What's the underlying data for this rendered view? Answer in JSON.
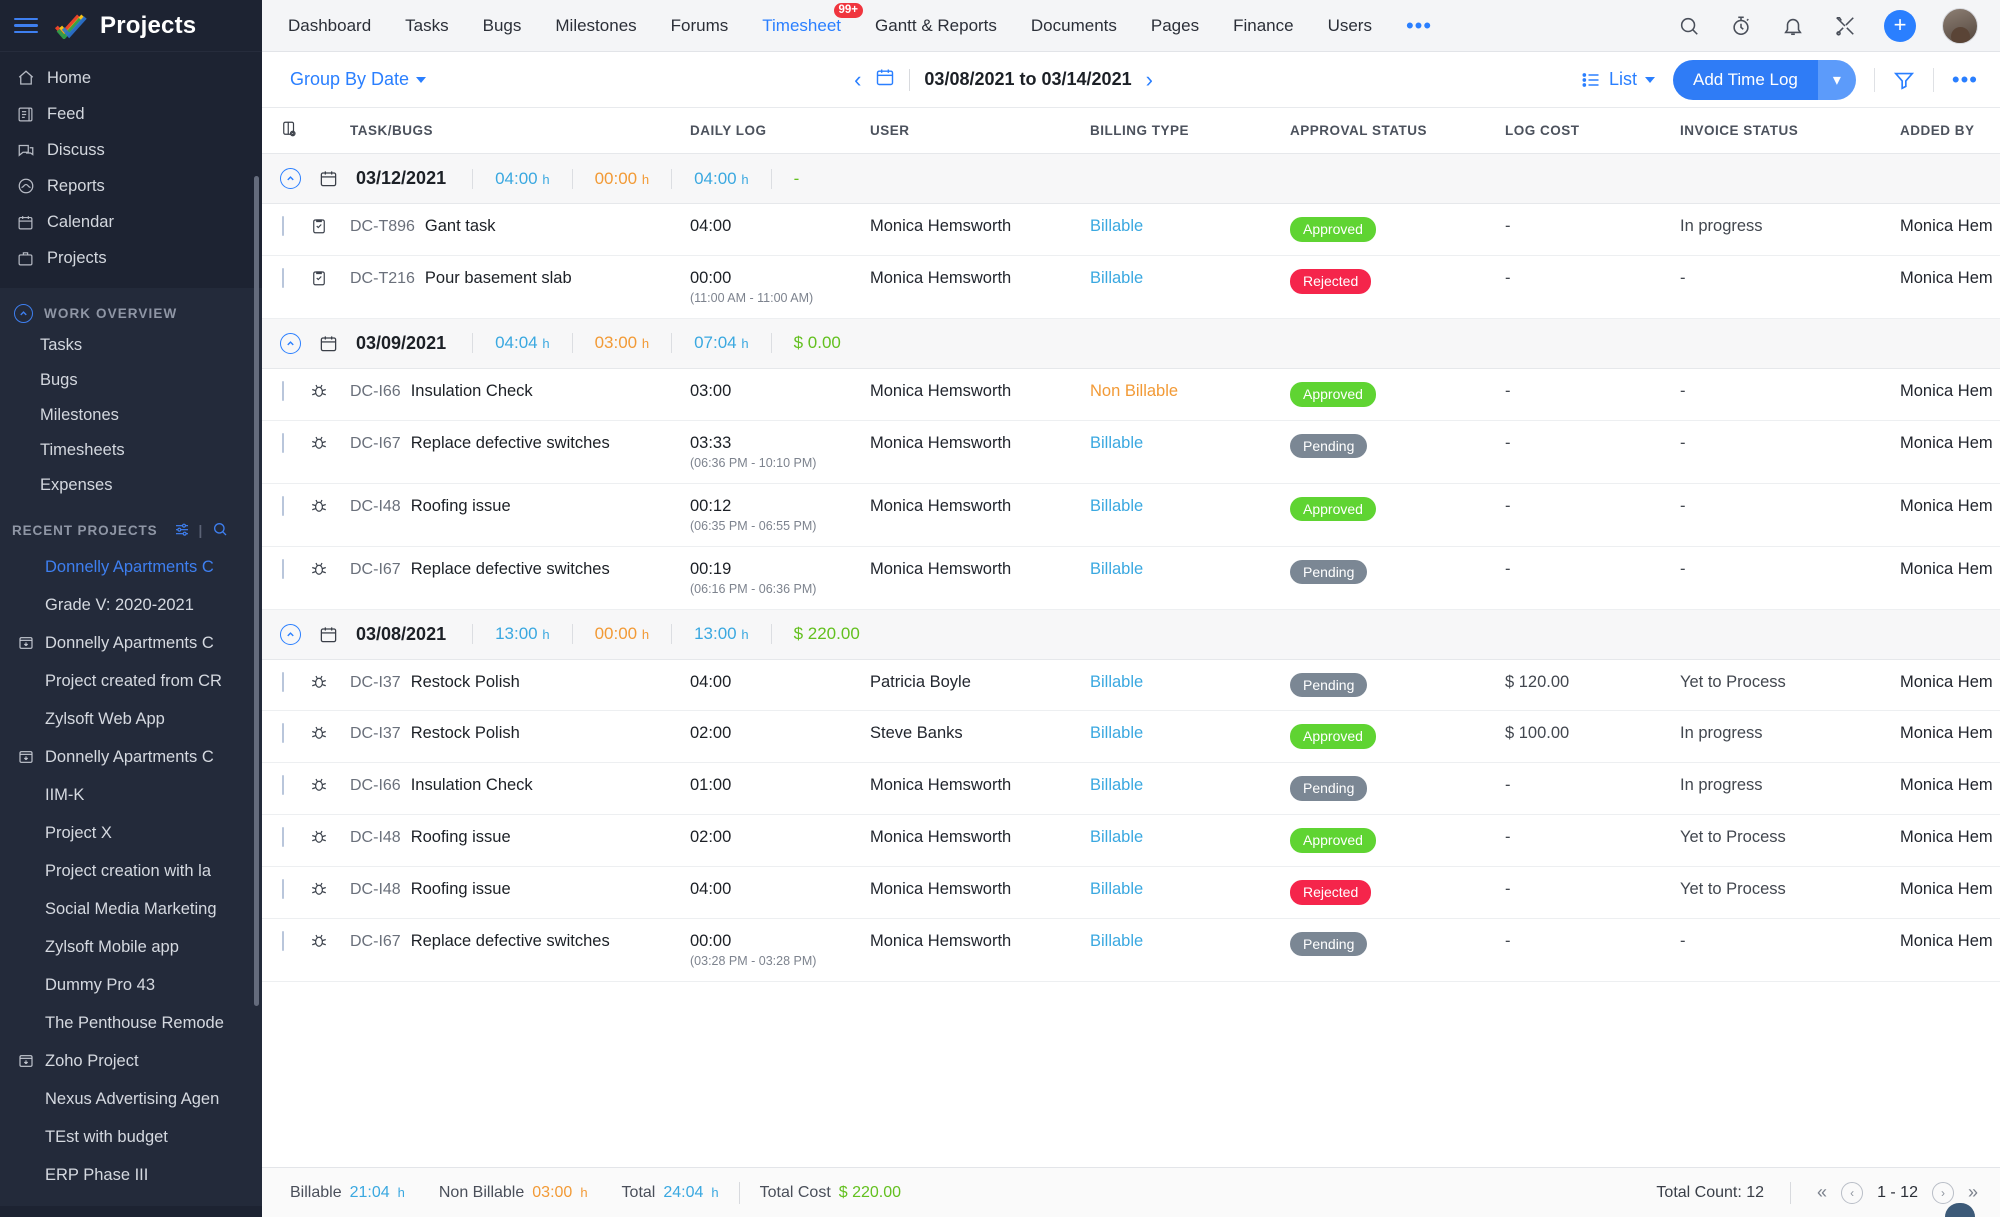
{
  "brand": {
    "name": "Projects",
    "hamburger_icon": "hamburger-icon",
    "logo_icon": "zoho-projects-logo-icon"
  },
  "sidebar": {
    "primary": [
      {
        "label": "Home",
        "icon": "home-icon"
      },
      {
        "label": "Feed",
        "icon": "feed-icon"
      },
      {
        "label": "Discuss",
        "icon": "discuss-icon"
      },
      {
        "label": "Reports",
        "icon": "reports-icon"
      },
      {
        "label": "Calendar",
        "icon": "calendar-icon"
      },
      {
        "label": "Projects",
        "icon": "projects-icon"
      }
    ],
    "work_overview": {
      "title": "WORK OVERVIEW",
      "collapse_icon": "chevron-up-circle-icon",
      "items": [
        {
          "label": "Tasks"
        },
        {
          "label": "Bugs"
        },
        {
          "label": "Milestones"
        },
        {
          "label": "Timesheets"
        },
        {
          "label": "Expenses"
        }
      ]
    },
    "recent_projects": {
      "title": "RECENT PROJECTS",
      "filter_icon": "sliders-icon",
      "search_icon": "search-icon",
      "items": [
        {
          "label": "Donnelly Apartments C",
          "active": true,
          "has_icon": false
        },
        {
          "label": "Grade V: 2020-2021",
          "active": false,
          "has_icon": false
        },
        {
          "label": "Donnelly Apartments C",
          "active": false,
          "has_icon": true
        },
        {
          "label": "Project created from CR",
          "active": false,
          "has_icon": false
        },
        {
          "label": "Zylsoft Web App",
          "active": false,
          "has_icon": false
        },
        {
          "label": "Donnelly Apartments C",
          "active": false,
          "has_icon": true
        },
        {
          "label": "IIM-K",
          "active": false,
          "has_icon": false
        },
        {
          "label": "Project X",
          "active": false,
          "has_icon": false
        },
        {
          "label": "Project creation with la",
          "active": false,
          "has_icon": false
        },
        {
          "label": "Social Media Marketing",
          "active": false,
          "has_icon": false
        },
        {
          "label": "Zylsoft Mobile app",
          "active": false,
          "has_icon": false
        },
        {
          "label": "Dummy Pro 43",
          "active": false,
          "has_icon": false
        },
        {
          "label": "The Penthouse Remode",
          "active": false,
          "has_icon": false
        },
        {
          "label": "Zoho Project",
          "active": false,
          "has_icon": true
        },
        {
          "label": "Nexus Advertising Agen",
          "active": false,
          "has_icon": false
        },
        {
          "label": "TEst with budget",
          "active": false,
          "has_icon": false
        },
        {
          "label": "ERP Phase III",
          "active": false,
          "has_icon": false
        }
      ]
    }
  },
  "topnav": {
    "items": [
      {
        "label": "Dashboard",
        "active": false
      },
      {
        "label": "Tasks",
        "active": false
      },
      {
        "label": "Bugs",
        "active": false
      },
      {
        "label": "Milestones",
        "active": false
      },
      {
        "label": "Forums",
        "active": false
      },
      {
        "label": "Timesheet",
        "active": true,
        "badge": "99+"
      },
      {
        "label": "Gantt & Reports",
        "active": false
      },
      {
        "label": "Documents",
        "active": false
      },
      {
        "label": "Pages",
        "active": false
      },
      {
        "label": "Finance",
        "active": false
      },
      {
        "label": "Users",
        "active": false
      }
    ],
    "more_label": "•••",
    "icons": [
      {
        "name": "search-icon"
      },
      {
        "name": "timer-icon"
      },
      {
        "name": "notification-bell-icon"
      },
      {
        "name": "tools-icon"
      }
    ],
    "add_label": "+",
    "avatar_name": "user-avatar"
  },
  "toolbar": {
    "group_by_label": "Group By Date",
    "prev_label": "‹",
    "next_label": "›",
    "calendar_icon": "calendar-icon",
    "date_range": "03/08/2021 to 03/14/2021",
    "view_label": "List",
    "view_icon": "list-icon",
    "add_time_log_label": "Add Time Log",
    "add_time_log_caret": "▾",
    "filter_icon": "filter-icon",
    "more_icon": "more-options-icon"
  },
  "table": {
    "settings_icon": "column-settings-icon",
    "headers": {
      "task": "TASK/BUGS",
      "daily_log": "DAILY LOG",
      "user": "USER",
      "billing": "BILLING TYPE",
      "approval": "APPROVAL STATUS",
      "cost": "LOG COST",
      "invoice": "INVOICE STATUS",
      "added_by": "ADDED BY"
    },
    "groups": [
      {
        "date": "03/12/2021",
        "billable": "04:00",
        "non_billable": "00:00",
        "total": "04:00",
        "cost": "-",
        "unit": "h",
        "rows": [
          {
            "icon": "task-icon",
            "id": "DC-T896",
            "name": "Gant task",
            "log": "04:00",
            "log_sub": "",
            "user": "Monica Hemsworth",
            "billing": "Billable",
            "billing_type": "billable",
            "approval": "Approved",
            "approval_type": "approved",
            "cost": "-",
            "invoice": "In progress",
            "added_by": "Monica Hem"
          },
          {
            "icon": "task-icon",
            "id": "DC-T216",
            "name": "Pour basement slab",
            "log": "00:00",
            "log_sub": "(11:00 AM - 11:00 AM)",
            "user": "Monica Hemsworth",
            "billing": "Billable",
            "billing_type": "billable",
            "approval": "Rejected",
            "approval_type": "rejected",
            "cost": "-",
            "invoice": "-",
            "added_by": "Monica Hem"
          }
        ]
      },
      {
        "date": "03/09/2021",
        "billable": "04:04",
        "non_billable": "03:00",
        "total": "07:04",
        "cost": "$ 0.00",
        "unit": "h",
        "rows": [
          {
            "icon": "bug-icon",
            "id": "DC-I66",
            "name": "Insulation Check",
            "log": "03:00",
            "log_sub": "",
            "user": "Monica Hemsworth",
            "billing": "Non Billable",
            "billing_type": "nonbillable",
            "approval": "Approved",
            "approval_type": "approved",
            "cost": "-",
            "invoice": "-",
            "added_by": "Monica Hem"
          },
          {
            "icon": "bug-icon",
            "id": "DC-I67",
            "name": "Replace defective switches",
            "log": "03:33",
            "log_sub": "(06:36 PM - 10:10 PM)",
            "user": "Monica Hemsworth",
            "billing": "Billable",
            "billing_type": "billable",
            "approval": "Pending",
            "approval_type": "pending",
            "cost": "-",
            "invoice": "-",
            "added_by": "Monica Hem"
          },
          {
            "icon": "bug-icon",
            "id": "DC-I48",
            "name": "Roofing issue",
            "log": "00:12",
            "log_sub": "(06:35 PM - 06:55 PM)",
            "user": "Monica Hemsworth",
            "billing": "Billable",
            "billing_type": "billable",
            "approval": "Approved",
            "approval_type": "approved",
            "cost": "-",
            "invoice": "-",
            "added_by": "Monica Hem"
          },
          {
            "icon": "bug-icon",
            "id": "DC-I67",
            "name": "Replace defective switches",
            "log": "00:19",
            "log_sub": "(06:16 PM - 06:36 PM)",
            "user": "Monica Hemsworth",
            "billing": "Billable",
            "billing_type": "billable",
            "approval": "Pending",
            "approval_type": "pending",
            "cost": "-",
            "invoice": "-",
            "added_by": "Monica Hem"
          }
        ]
      },
      {
        "date": "03/08/2021",
        "billable": "13:00",
        "non_billable": "00:00",
        "total": "13:00",
        "cost": "$ 220.00",
        "unit": "h",
        "rows": [
          {
            "icon": "bug-icon",
            "id": "DC-I37",
            "name": "Restock Polish",
            "log": "04:00",
            "log_sub": "",
            "user": "Patricia Boyle",
            "billing": "Billable",
            "billing_type": "billable",
            "approval": "Pending",
            "approval_type": "pending",
            "cost": "$ 120.00",
            "invoice": "Yet to Process",
            "added_by": "Monica Hem"
          },
          {
            "icon": "bug-icon",
            "id": "DC-I37",
            "name": "Restock Polish",
            "log": "02:00",
            "log_sub": "",
            "user": "Steve Banks",
            "billing": "Billable",
            "billing_type": "billable",
            "approval": "Approved",
            "approval_type": "approved",
            "cost": "$ 100.00",
            "invoice": "In progress",
            "added_by": "Monica Hem"
          },
          {
            "icon": "bug-icon",
            "id": "DC-I66",
            "name": "Insulation Check",
            "log": "01:00",
            "log_sub": "",
            "user": "Monica Hemsworth",
            "billing": "Billable",
            "billing_type": "billable",
            "approval": "Pending",
            "approval_type": "pending",
            "cost": "-",
            "invoice": "In progress",
            "added_by": "Monica Hem"
          },
          {
            "icon": "bug-icon",
            "id": "DC-I48",
            "name": "Roofing issue",
            "log": "02:00",
            "log_sub": "",
            "user": "Monica Hemsworth",
            "billing": "Billable",
            "billing_type": "billable",
            "approval": "Approved",
            "approval_type": "approved",
            "cost": "-",
            "invoice": "Yet to Process",
            "added_by": "Monica Hem"
          },
          {
            "icon": "bug-icon",
            "id": "DC-I48",
            "name": "Roofing issue",
            "log": "04:00",
            "log_sub": "",
            "user": "Monica Hemsworth",
            "billing": "Billable",
            "billing_type": "billable",
            "approval": "Rejected",
            "approval_type": "rejected",
            "cost": "-",
            "invoice": "Yet to Process",
            "added_by": "Monica Hem"
          },
          {
            "icon": "bug-icon",
            "id": "DC-I67",
            "name": "Replace defective switches",
            "log": "00:00",
            "log_sub": "(03:28 PM - 03:28 PM)",
            "user": "Monica Hemsworth",
            "billing": "Billable",
            "billing_type": "billable",
            "approval": "Pending",
            "approval_type": "pending",
            "cost": "-",
            "invoice": "-",
            "added_by": "Monica Hem"
          }
        ]
      }
    ]
  },
  "footer": {
    "billable_label": "Billable",
    "billable_value": "21:04",
    "non_billable_label": "Non Billable",
    "non_billable_value": "03:00",
    "total_label": "Total",
    "total_value": "24:04",
    "unit": "h",
    "total_cost_label": "Total Cost",
    "total_cost_value": "$ 220.00",
    "total_count_label": "Total Count: 12",
    "page_range": "1 - 12",
    "first_icon": "«",
    "prev_icon": "‹",
    "next_icon": "›",
    "last_icon": "»"
  }
}
